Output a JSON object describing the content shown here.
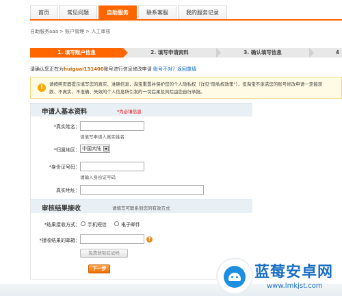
{
  "nav": {
    "tabs": [
      "首页",
      "常见问题",
      "自助服务",
      "联系客服",
      "我的服务记录"
    ],
    "active_index": 2
  },
  "breadcrumb": "自助服务aaa > 账户管理 > 人工审核",
  "steps": [
    "1. 填写账户信息",
    "2. 填写申请资料",
    "3. 确认填写信息",
    "4"
  ],
  "notice": {
    "prefix": "请确认您正在为",
    "account": "huiguai131400",
    "suffix": "账号进行信息修改申请",
    "link": "账号不对？返回重填"
  },
  "alert": {
    "line1": "请按照页面提示填写您的真实、准确信息，淘宝重置并保护您的个人隐私权（详见\"隐私权政策\"），但淘宝不承诺您的账号修改申请一定能获",
    "line2": "款、不真实、不准确、失效的个人信息所引发的一切后果及风险由您自行承担。"
  },
  "section_applicant": {
    "title": "申请人基本资料",
    "note": "*为必填信息"
  },
  "fields": {
    "real_name": {
      "label": "*真实姓名：",
      "value": "",
      "hint": "请填写申请人真实姓名"
    },
    "region": {
      "label": "*归属地区：",
      "value": "中国大陆"
    },
    "id_number": {
      "label": "*身份证号码：",
      "value": "",
      "hint": "请输入身份证号码"
    },
    "address": {
      "label": "真实地址：",
      "value": ""
    }
  },
  "section_result": {
    "title": "审核结果接收",
    "note": "请填写可联系到您的有效方式"
  },
  "receive": {
    "label": "*结果接收方式：",
    "options": [
      "手机短信",
      "电子邮件"
    ]
  },
  "email": {
    "label": "*接收结果的邮箱：",
    "value": ""
  },
  "buttons": {
    "get_code": "免费获取验证码",
    "next": "下一步"
  },
  "watermark": {
    "name": "蓝莓安卓网",
    "url": "www.lmkjst.com"
  },
  "colors": {
    "accent": "#ff6600",
    "link": "#0066cc",
    "section_bg": "#e9f0f5",
    "alert_bg": "#fffbe5"
  }
}
